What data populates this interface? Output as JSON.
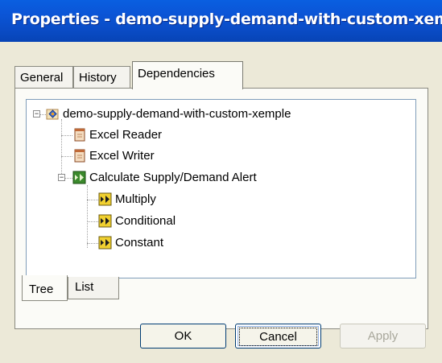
{
  "window": {
    "title": "Properties - demo-supply-demand-with-custom-xem…"
  },
  "tabs": [
    {
      "label": "General",
      "active": false
    },
    {
      "label": "History",
      "active": false
    },
    {
      "label": "Dependencies",
      "active": true
    }
  ],
  "tree": {
    "root": {
      "label": "demo-supply-demand-with-custom-xemple",
      "icon": "workflow-diamond-icon",
      "expanded": true
    },
    "children": [
      {
        "label": "Excel Reader",
        "icon": "document-icon"
      },
      {
        "label": "Excel Writer",
        "icon": "document-icon"
      },
      {
        "label": "Calculate Supply/Demand Alert",
        "icon": "step-arrow-icon",
        "expanded": true,
        "children": [
          {
            "label": "Multiply",
            "icon": "step-arrow-icon"
          },
          {
            "label": "Conditional",
            "icon": "step-arrow-icon"
          },
          {
            "label": "Constant",
            "icon": "step-arrow-icon"
          }
        ]
      }
    ]
  },
  "view_tabs": [
    {
      "label": "Tree",
      "active": true
    },
    {
      "label": "List",
      "active": false
    }
  ],
  "buttons": {
    "ok": "OK",
    "cancel": "Cancel",
    "apply": "Apply"
  },
  "colors": {
    "title_bar": "#0a53d4",
    "dialog_bg": "#ece9d8",
    "tree_border": "#7f9db9"
  }
}
